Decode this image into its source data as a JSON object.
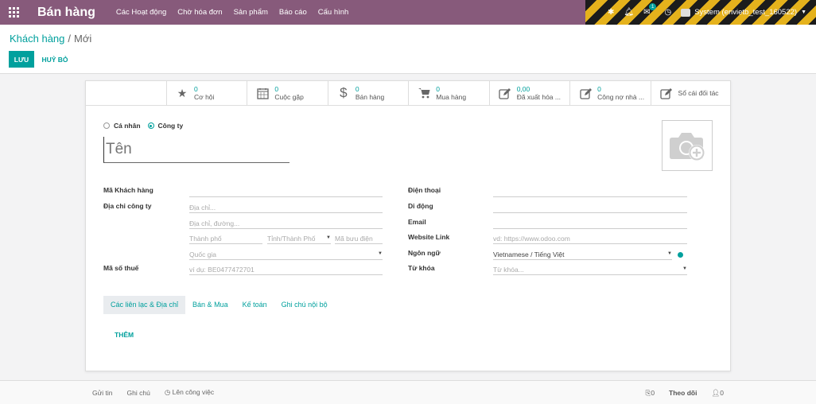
{
  "navbar": {
    "brand": "Bán hàng",
    "menu": [
      "Các Hoạt động",
      "Chờ hóa đơn",
      "Sản phẩm",
      "Báo cáo",
      "Cấu hình"
    ],
    "messages_badge": "1",
    "user": "System (envietb_test_160522)"
  },
  "breadcrumb": {
    "parent": "Khách hàng",
    "separator": "/",
    "current": "Mới"
  },
  "buttons": {
    "save": "LƯU",
    "discard": "HUỶ BỎ"
  },
  "smart_buttons": [
    {
      "icon": "star-icon",
      "value": "0",
      "label": "Cơ hội"
    },
    {
      "icon": "calendar-icon",
      "value": "0",
      "label": "Cuộc gặp"
    },
    {
      "icon": "dollar-icon",
      "value": "0",
      "label": "Bán hàng"
    },
    {
      "icon": "cart-icon",
      "value": "0",
      "label": "Mua hàng"
    },
    {
      "icon": "edit-icon",
      "value": "0,00",
      "label": "Đã xuất hóa ..."
    },
    {
      "icon": "edit-icon",
      "value": "0",
      "label": "Công nợ nhà ..."
    },
    {
      "icon": "edit-icon",
      "value": "",
      "label": "Sổ cái đối tác"
    }
  ],
  "company_type": {
    "individual": "Cá nhân",
    "company": "Công ty",
    "selected": "company"
  },
  "name_placeholder": "Tên",
  "left_fields": {
    "customer_code_label": "Mã Khách hàng",
    "address_label": "Địa chỉ công ty",
    "street_placeholder": "Địa chỉ...",
    "street2_placeholder": "Địa chỉ, đường...",
    "city_placeholder": "Thành phố",
    "state_placeholder": "Tỉnh/Thành Phố",
    "zip_placeholder": "Mã bưu điện",
    "country_placeholder": "Quốc gia",
    "vat_label": "Mã số thuế",
    "vat_placeholder": "ví dụ: BE0477472701"
  },
  "right_fields": {
    "phone_label": "Điện thoại",
    "mobile_label": "Di động",
    "email_label": "Email",
    "website_label": "Website Link",
    "website_placeholder": "vd: https://www.odoo.com",
    "language_label": "Ngôn ngữ",
    "language_value": "Vietnamese / Tiếng Việt",
    "tags_label": "Từ khóa",
    "tags_placeholder": "Từ khóa..."
  },
  "tabs": [
    "Các liên lạc & Địa chỉ",
    "Bán & Mua",
    "Kế toán",
    "Ghi chú nội bộ"
  ],
  "add_button": "THÊM",
  "chatter": {
    "send_message": "Gửi tin",
    "log_note": "Ghi chú",
    "schedule_activity": "Lên công việc",
    "attachments": "0",
    "follow": "Theo dõi",
    "followers": "0"
  },
  "colors": {
    "navbar": "#875a7b",
    "accent": "#00a09d"
  }
}
